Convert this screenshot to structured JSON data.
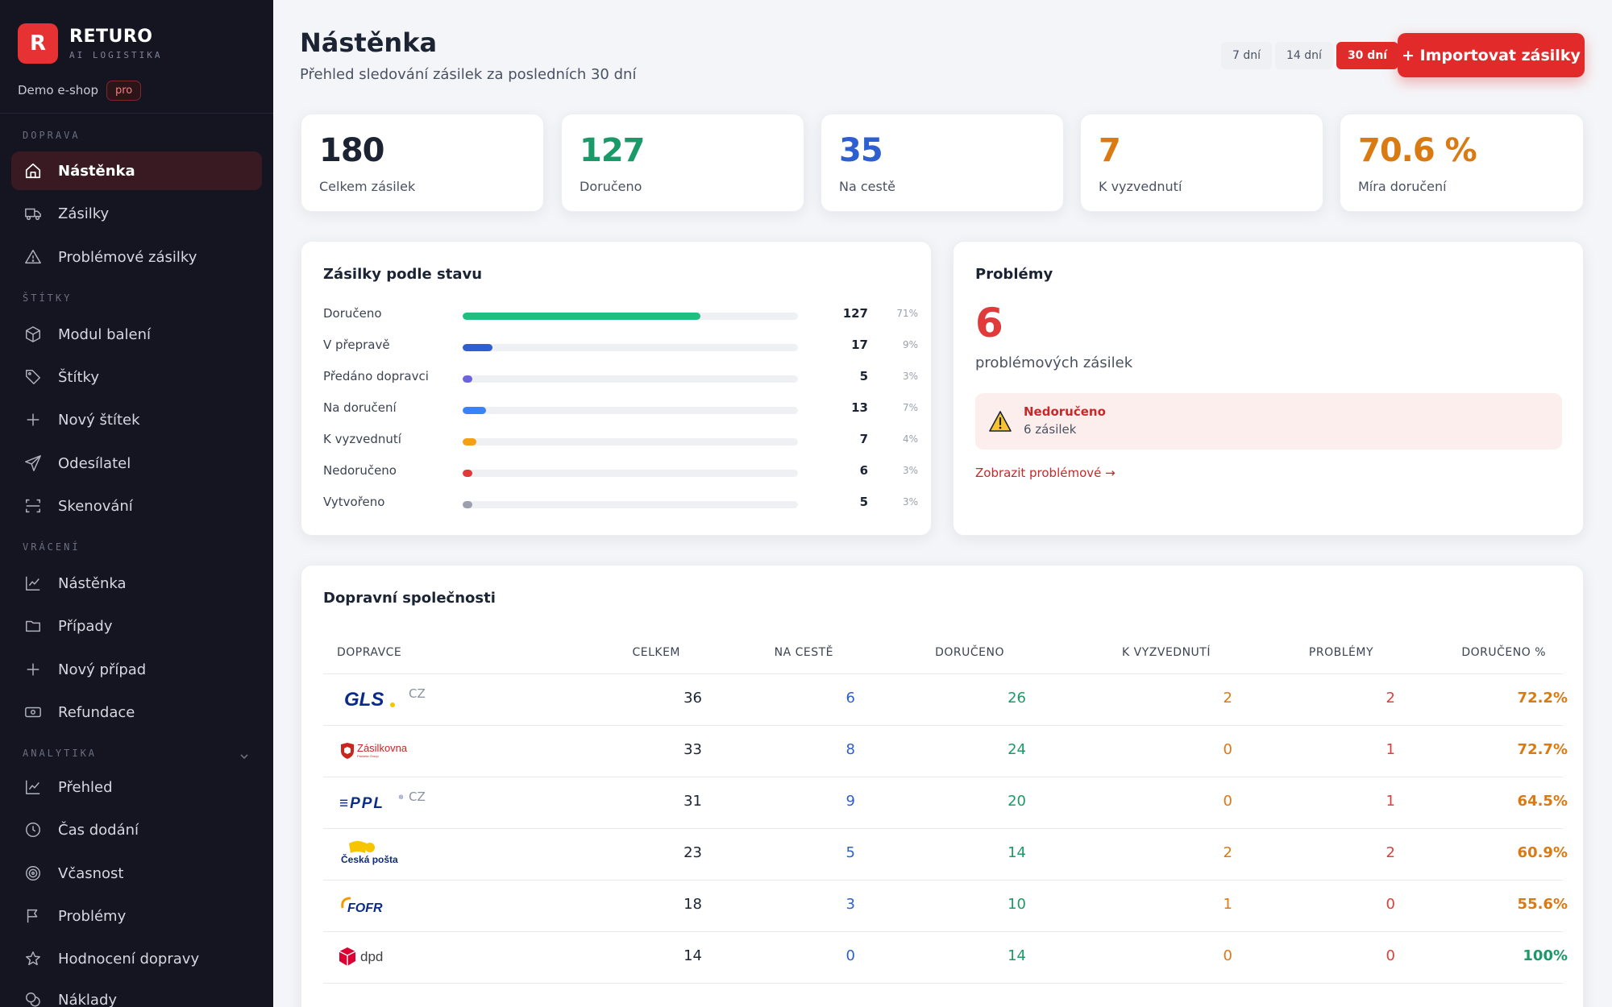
{
  "brand": {
    "logo_letter": "R",
    "name": "RETURO",
    "subtitle": "AI LOGISTIKA",
    "shop": "Demo e-shop",
    "plan": "pro"
  },
  "sidebar": {
    "sections": [
      {
        "label": "DOPRAVA",
        "items": [
          {
            "label": "Nástěnka",
            "icon": "home-icon",
            "active": true
          },
          {
            "label": "Zásilky",
            "icon": "truck-icon"
          },
          {
            "label": "Problémové zásilky",
            "icon": "warning-icon"
          }
        ]
      },
      {
        "label": "ŠTÍTKY",
        "items": [
          {
            "label": "Modul balení",
            "icon": "package-icon"
          },
          {
            "label": "Štítky",
            "icon": "tag-icon"
          },
          {
            "label": "Nový štítek",
            "icon": "plus-icon"
          },
          {
            "label": "Odesílatel",
            "icon": "send-icon"
          },
          {
            "label": "Skenování",
            "icon": "scan-icon"
          }
        ]
      },
      {
        "label": "VRÁCENÍ",
        "items": [
          {
            "label": "Nástěnka",
            "icon": "chart-line-icon"
          },
          {
            "label": "Případy",
            "icon": "folder-icon"
          },
          {
            "label": "Nový případ",
            "icon": "plus-icon"
          },
          {
            "label": "Refundace",
            "icon": "banknote-icon"
          }
        ]
      },
      {
        "label": "ANALYTIKA",
        "items": [
          {
            "label": "Přehled",
            "icon": "chart-line-icon"
          },
          {
            "label": "Čas dodání",
            "icon": "clock-icon"
          },
          {
            "label": "Včasnost",
            "icon": "target-icon"
          },
          {
            "label": "Problémy",
            "icon": "flag-icon"
          },
          {
            "label": "Hodnocení dopravy",
            "icon": "star-icon"
          },
          {
            "label": "Náklady",
            "icon": "coins-icon"
          }
        ]
      }
    ]
  },
  "header": {
    "title": "Nástěnka",
    "subtitle": "Přehled sledování zásilek za posledních 30 dní",
    "ranges": [
      {
        "label": "7 dní"
      },
      {
        "label": "14 dní"
      },
      {
        "label": "30 dní",
        "active": true
      }
    ],
    "import_label": "+ Importovat zásilky"
  },
  "stats": [
    {
      "value": "180",
      "label": "Celkem zásilek",
      "color": "#1c2434"
    },
    {
      "value": "127",
      "label": "Doručeno",
      "color": "#1a9a68"
    },
    {
      "value": "35",
      "label": "Na cestě",
      "color": "#2d5fd1"
    },
    {
      "value": "7",
      "label": "K vyzvednutí",
      "color": "#d97a12"
    },
    {
      "value": "70.6 %",
      "label": "Míra doručení",
      "color": "#d97a12"
    }
  ],
  "status_card": {
    "title": "Zásilky podle stavu",
    "rows": [
      {
        "label": "Doručeno",
        "count": "127",
        "pct": "71%",
        "fraction": 0.71,
        "color": "#1fbf7f"
      },
      {
        "label": "V přepravě",
        "count": "17",
        "pct": "9%",
        "fraction": 0.09,
        "color": "#2d5fd1"
      },
      {
        "label": "Předáno dopravci",
        "count": "5",
        "pct": "3%",
        "fraction": 0.03,
        "color": "#6c63e0"
      },
      {
        "label": "Na doručení",
        "count": "13",
        "pct": "7%",
        "fraction": 0.07,
        "color": "#3b82f6"
      },
      {
        "label": "K vyzvednutí",
        "count": "7",
        "pct": "4%",
        "fraction": 0.04,
        "color": "#f2a116"
      },
      {
        "label": "Nedoručeno",
        "count": "6",
        "pct": "3%",
        "fraction": 0.03,
        "color": "#e03a3a"
      },
      {
        "label": "Vytvořeno",
        "count": "5",
        "pct": "3%",
        "fraction": 0.03,
        "color": "#9aa0ad"
      }
    ]
  },
  "problems_card": {
    "title": "Problémy",
    "count": "6",
    "count_label": "problémových zásilek",
    "alert_title": "Nedoručeno",
    "alert_sub": "6 zásilek",
    "link": "Zobrazit problémové →"
  },
  "carriers_card": {
    "title": "Dopravní společnosti",
    "columns": [
      "DOPRAVCE",
      "CELKEM",
      "NA CESTĚ",
      "DORUČENO",
      "K VYZVEDNUTÍ",
      "PROBLÉMY",
      "DORUČENO %"
    ],
    "rows": [
      {
        "logo": "GLS",
        "country": "CZ",
        "total": "36",
        "transit": "6",
        "delivered": "26",
        "pickup": "2",
        "problems": "2",
        "rate": "72.2%"
      },
      {
        "logo": "Zásilkovna",
        "country": "",
        "total": "33",
        "transit": "8",
        "delivered": "24",
        "pickup": "0",
        "problems": "1",
        "rate": "72.7%"
      },
      {
        "logo": "PPL",
        "country": "CZ",
        "total": "31",
        "transit": "9",
        "delivered": "20",
        "pickup": "0",
        "problems": "1",
        "rate": "64.5%"
      },
      {
        "logo": "Česká pošta",
        "country": "",
        "total": "23",
        "transit": "5",
        "delivered": "14",
        "pickup": "2",
        "problems": "2",
        "rate": "60.9%"
      },
      {
        "logo": "FOFR",
        "country": "",
        "total": "18",
        "transit": "3",
        "delivered": "10",
        "pickup": "1",
        "problems": "0",
        "rate": "55.6%"
      },
      {
        "logo": "dpd",
        "country": "",
        "total": "14",
        "transit": "0",
        "delivered": "14",
        "pickup": "0",
        "problems": "0",
        "rate": "100%"
      }
    ]
  }
}
